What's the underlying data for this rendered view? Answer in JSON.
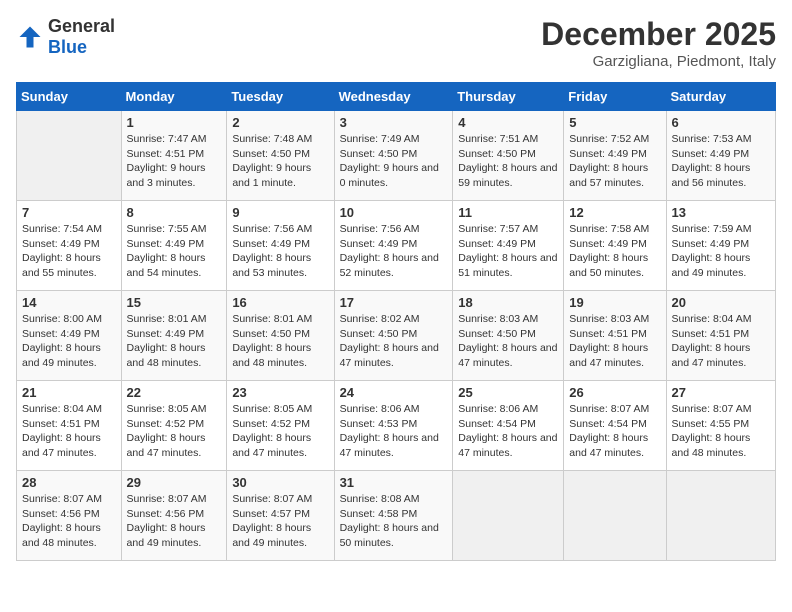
{
  "logo": {
    "text_general": "General",
    "text_blue": "Blue"
  },
  "title": "December 2025",
  "subtitle": "Garzigliana, Piedmont, Italy",
  "header_color": "#1565c0",
  "days_of_week": [
    "Sunday",
    "Monday",
    "Tuesday",
    "Wednesday",
    "Thursday",
    "Friday",
    "Saturday"
  ],
  "weeks": [
    [
      {
        "day": "",
        "sunrise": "",
        "sunset": "",
        "daylight": ""
      },
      {
        "day": "1",
        "sunrise": "Sunrise: 7:47 AM",
        "sunset": "Sunset: 4:51 PM",
        "daylight": "Daylight: 9 hours and 3 minutes."
      },
      {
        "day": "2",
        "sunrise": "Sunrise: 7:48 AM",
        "sunset": "Sunset: 4:50 PM",
        "daylight": "Daylight: 9 hours and 1 minute."
      },
      {
        "day": "3",
        "sunrise": "Sunrise: 7:49 AM",
        "sunset": "Sunset: 4:50 PM",
        "daylight": "Daylight: 9 hours and 0 minutes."
      },
      {
        "day": "4",
        "sunrise": "Sunrise: 7:51 AM",
        "sunset": "Sunset: 4:50 PM",
        "daylight": "Daylight: 8 hours and 59 minutes."
      },
      {
        "day": "5",
        "sunrise": "Sunrise: 7:52 AM",
        "sunset": "Sunset: 4:49 PM",
        "daylight": "Daylight: 8 hours and 57 minutes."
      },
      {
        "day": "6",
        "sunrise": "Sunrise: 7:53 AM",
        "sunset": "Sunset: 4:49 PM",
        "daylight": "Daylight: 8 hours and 56 minutes."
      }
    ],
    [
      {
        "day": "7",
        "sunrise": "Sunrise: 7:54 AM",
        "sunset": "Sunset: 4:49 PM",
        "daylight": "Daylight: 8 hours and 55 minutes."
      },
      {
        "day": "8",
        "sunrise": "Sunrise: 7:55 AM",
        "sunset": "Sunset: 4:49 PM",
        "daylight": "Daylight: 8 hours and 54 minutes."
      },
      {
        "day": "9",
        "sunrise": "Sunrise: 7:56 AM",
        "sunset": "Sunset: 4:49 PM",
        "daylight": "Daylight: 8 hours and 53 minutes."
      },
      {
        "day": "10",
        "sunrise": "Sunrise: 7:56 AM",
        "sunset": "Sunset: 4:49 PM",
        "daylight": "Daylight: 8 hours and 52 minutes."
      },
      {
        "day": "11",
        "sunrise": "Sunrise: 7:57 AM",
        "sunset": "Sunset: 4:49 PM",
        "daylight": "Daylight: 8 hours and 51 minutes."
      },
      {
        "day": "12",
        "sunrise": "Sunrise: 7:58 AM",
        "sunset": "Sunset: 4:49 PM",
        "daylight": "Daylight: 8 hours and 50 minutes."
      },
      {
        "day": "13",
        "sunrise": "Sunrise: 7:59 AM",
        "sunset": "Sunset: 4:49 PM",
        "daylight": "Daylight: 8 hours and 49 minutes."
      }
    ],
    [
      {
        "day": "14",
        "sunrise": "Sunrise: 8:00 AM",
        "sunset": "Sunset: 4:49 PM",
        "daylight": "Daylight: 8 hours and 49 minutes."
      },
      {
        "day": "15",
        "sunrise": "Sunrise: 8:01 AM",
        "sunset": "Sunset: 4:49 PM",
        "daylight": "Daylight: 8 hours and 48 minutes."
      },
      {
        "day": "16",
        "sunrise": "Sunrise: 8:01 AM",
        "sunset": "Sunset: 4:50 PM",
        "daylight": "Daylight: 8 hours and 48 minutes."
      },
      {
        "day": "17",
        "sunrise": "Sunrise: 8:02 AM",
        "sunset": "Sunset: 4:50 PM",
        "daylight": "Daylight: 8 hours and 47 minutes."
      },
      {
        "day": "18",
        "sunrise": "Sunrise: 8:03 AM",
        "sunset": "Sunset: 4:50 PM",
        "daylight": "Daylight: 8 hours and 47 minutes."
      },
      {
        "day": "19",
        "sunrise": "Sunrise: 8:03 AM",
        "sunset": "Sunset: 4:51 PM",
        "daylight": "Daylight: 8 hours and 47 minutes."
      },
      {
        "day": "20",
        "sunrise": "Sunrise: 8:04 AM",
        "sunset": "Sunset: 4:51 PM",
        "daylight": "Daylight: 8 hours and 47 minutes."
      }
    ],
    [
      {
        "day": "21",
        "sunrise": "Sunrise: 8:04 AM",
        "sunset": "Sunset: 4:51 PM",
        "daylight": "Daylight: 8 hours and 47 minutes."
      },
      {
        "day": "22",
        "sunrise": "Sunrise: 8:05 AM",
        "sunset": "Sunset: 4:52 PM",
        "daylight": "Daylight: 8 hours and 47 minutes."
      },
      {
        "day": "23",
        "sunrise": "Sunrise: 8:05 AM",
        "sunset": "Sunset: 4:52 PM",
        "daylight": "Daylight: 8 hours and 47 minutes."
      },
      {
        "day": "24",
        "sunrise": "Sunrise: 8:06 AM",
        "sunset": "Sunset: 4:53 PM",
        "daylight": "Daylight: 8 hours and 47 minutes."
      },
      {
        "day": "25",
        "sunrise": "Sunrise: 8:06 AM",
        "sunset": "Sunset: 4:54 PM",
        "daylight": "Daylight: 8 hours and 47 minutes."
      },
      {
        "day": "26",
        "sunrise": "Sunrise: 8:07 AM",
        "sunset": "Sunset: 4:54 PM",
        "daylight": "Daylight: 8 hours and 47 minutes."
      },
      {
        "day": "27",
        "sunrise": "Sunrise: 8:07 AM",
        "sunset": "Sunset: 4:55 PM",
        "daylight": "Daylight: 8 hours and 48 minutes."
      }
    ],
    [
      {
        "day": "28",
        "sunrise": "Sunrise: 8:07 AM",
        "sunset": "Sunset: 4:56 PM",
        "daylight": "Daylight: 8 hours and 48 minutes."
      },
      {
        "day": "29",
        "sunrise": "Sunrise: 8:07 AM",
        "sunset": "Sunset: 4:56 PM",
        "daylight": "Daylight: 8 hours and 49 minutes."
      },
      {
        "day": "30",
        "sunrise": "Sunrise: 8:07 AM",
        "sunset": "Sunset: 4:57 PM",
        "daylight": "Daylight: 8 hours and 49 minutes."
      },
      {
        "day": "31",
        "sunrise": "Sunrise: 8:08 AM",
        "sunset": "Sunset: 4:58 PM",
        "daylight": "Daylight: 8 hours and 50 minutes."
      },
      {
        "day": "",
        "sunrise": "",
        "sunset": "",
        "daylight": ""
      },
      {
        "day": "",
        "sunrise": "",
        "sunset": "",
        "daylight": ""
      },
      {
        "day": "",
        "sunrise": "",
        "sunset": "",
        "daylight": ""
      }
    ]
  ]
}
